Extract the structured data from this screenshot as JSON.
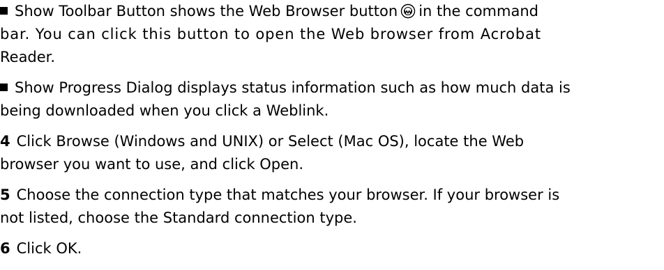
{
  "paragraphs": {
    "toolbar_button": {
      "line1_before_icon": "Show Toolbar Button shows the Web Browser button",
      "line1_after_icon": "in the command",
      "line2": "bar. You can click this button to open the Web browser from Acrobat",
      "line3": "Reader."
    },
    "progress_dialog": {
      "line1": "Show Progress Dialog displays status information such as how much data is",
      "line2": "being downloaded when you click a Weblink."
    },
    "step4": {
      "number": "4",
      "line1": "Click Browse (Windows and UNIX) or Select (Mac OS), locate the Web",
      "line2": "browser you want to use, and click Open."
    },
    "step5": {
      "number": "5",
      "line1": "Choose the connection type that matches your browser. If your browser is",
      "line2": "not listed, choose the Standard connection type."
    },
    "step6": {
      "number": "6",
      "line1": "Click OK."
    }
  },
  "icons": {
    "web_browser_button": "web-browser-icon"
  }
}
